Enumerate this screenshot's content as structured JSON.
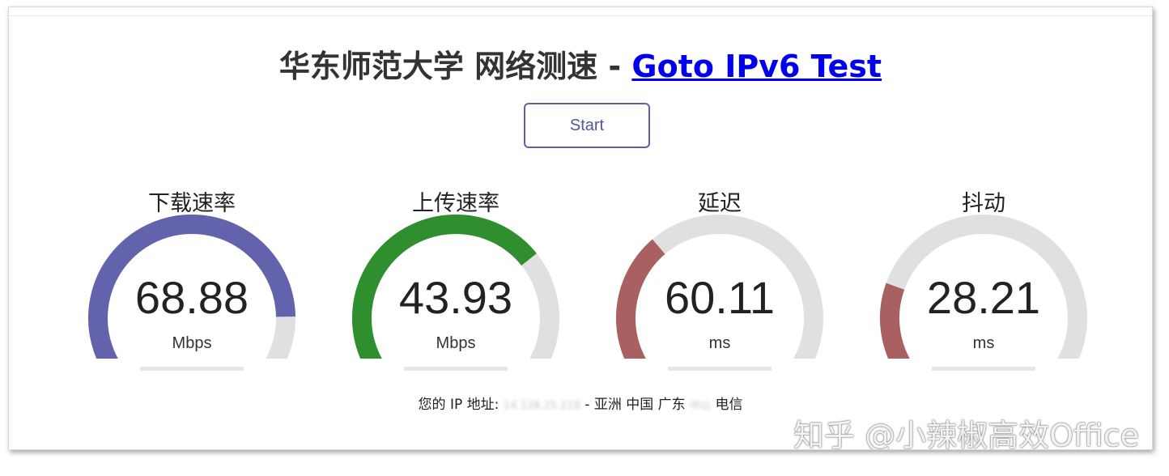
{
  "header": {
    "title": "华东师范大学 网络测速 - ",
    "link_label": "Goto IPv6 Test"
  },
  "controls": {
    "start_label": "Start"
  },
  "meters": [
    {
      "label": "下载速率",
      "value": "68.88",
      "unit": "Mbps",
      "color": "#6363ad",
      "fraction": 0.83
    },
    {
      "label": "上传速率",
      "value": "43.93",
      "unit": "Mbps",
      "color": "#2f8f2f",
      "fraction": 0.69
    },
    {
      "label": "延迟",
      "value": "60.11",
      "unit": "ms",
      "color": "#a86060",
      "fraction": 0.35
    },
    {
      "label": "抖动",
      "value": "28.21",
      "unit": "ms",
      "color": "#a86060",
      "fraction": 0.24
    }
  ],
  "ip_info": {
    "prefix": "您的 IP 地址: ",
    "ip": "14.128.25.218",
    "location": " - 亚洲 中国 广东 ",
    "city": "中山",
    "isp": " 电信"
  },
  "watermark": "知乎 @小辣椒高效Office",
  "colors": {
    "track": "#e0e0e0"
  }
}
